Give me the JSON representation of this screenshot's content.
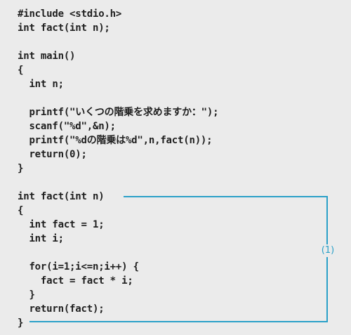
{
  "code": {
    "lines": [
      "#include <stdio.h>",
      "int fact(int n);",
      "",
      "int main()",
      "{",
      "  int n;",
      "",
      "  printf(\"いくつの階乗を求めますか：\");",
      "  scanf(\"%d\",&n);",
      "  printf(\"%dの階乗は%d\",n,fact(n));",
      "  return(0);",
      "}",
      "",
      "int fact(int n)",
      "{",
      "  int fact = 1;",
      "  int i;",
      "",
      "  for(i=1;i<=n;i++) {",
      "    fact = fact * i;",
      "  }",
      "  return(fact);",
      "}"
    ]
  },
  "callout": {
    "label": "(1)",
    "color": "#2aa0c8"
  },
  "colors": {
    "background": "#ebebeb",
    "text": "#1f1f1f"
  }
}
